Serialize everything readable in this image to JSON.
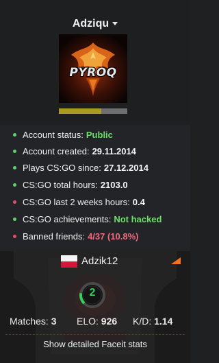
{
  "profile": {
    "username": "Adziqu",
    "avatar_text": "PYROQ",
    "level_progress": 0.62,
    "colors": {
      "level_fill": "#a89a23",
      "level_track": "#6e6e6e"
    }
  },
  "stats": [
    {
      "label": "Account status:",
      "value": "Public",
      "status": "good"
    },
    {
      "label": "Account created:",
      "value": "29.11.2014",
      "status": "good"
    },
    {
      "label": "Plays CS:GO since:",
      "value": "27.12.2014",
      "status": "good"
    },
    {
      "label": "CS:GO total hours:",
      "value": "2103.0",
      "status": "good"
    },
    {
      "label": "CS:GO last 2 weeks hours:",
      "value": "0.4",
      "status": "bad"
    },
    {
      "label": "CS:GO achievements:",
      "value": "Not hacked",
      "status": "good"
    },
    {
      "label": "Banned friends:",
      "value": "4/37 (10.8%)",
      "status": "bad"
    }
  ],
  "status_colors": {
    "good": "#5fd16b",
    "bad": "#e0506a",
    "good_value": "#6ee06a",
    "bad_value": "#ef6a7d"
  },
  "faceit": {
    "nickname": "Adzik12",
    "country": "Poland",
    "level": "2",
    "matches_label": "Matches:",
    "matches": "3",
    "elo_label": "ELO:",
    "elo": "926",
    "kd_label": "K/D:",
    "kd": "1.14",
    "detail_button": "Show detailed Faceit stats",
    "accent": "#f4741d",
    "level_color": "#35d05c"
  }
}
